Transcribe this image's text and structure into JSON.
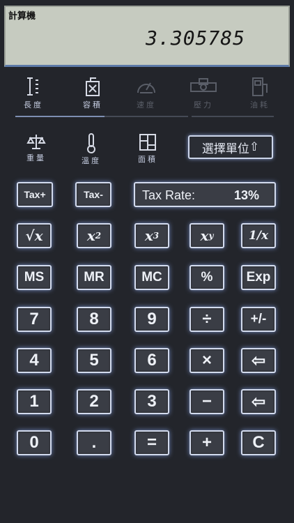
{
  "display": {
    "title": "計算機",
    "value": "3.305785"
  },
  "tabs_row1": [
    {
      "label": "長度",
      "icon": "ruler-icon"
    },
    {
      "label": "容積",
      "icon": "fuel-can-icon"
    },
    {
      "label": "速度",
      "icon": "speedometer-icon"
    },
    {
      "label": "壓力",
      "icon": "pressure-gauge-icon"
    },
    {
      "label": "油耗",
      "icon": "fuel-pump-icon"
    }
  ],
  "tabs_row2": [
    {
      "label": "重量",
      "icon": "scale-icon"
    },
    {
      "label": "溫度",
      "icon": "thermometer-icon"
    },
    {
      "label": "面積",
      "icon": "area-grid-icon"
    }
  ],
  "unit_selector": {
    "label": "選擇單位",
    "icon": "arrow-up-icon",
    "arrow": "⇧"
  },
  "tax": {
    "plus": "Tax+",
    "minus": "Tax-",
    "rate_label": "Tax Rate:",
    "rate_value": "13%"
  },
  "buttons": {
    "sqrt": "√x",
    "square_base": "x",
    "square_exp": "2",
    "cube_base": "x",
    "cube_exp": "3",
    "power_base": "x",
    "power_exp": "y",
    "reciprocal": "1/x",
    "ms": "MS",
    "mr": "MR",
    "mc": "MC",
    "percent": "%",
    "exp": "Exp",
    "n7": "7",
    "n8": "8",
    "n9": "9",
    "divide": "÷",
    "plusminus": "+/-",
    "n4": "4",
    "n5": "5",
    "n6": "6",
    "multiply": "×",
    "backspace1": "⇦",
    "n1": "1",
    "n2": "2",
    "n3": "3",
    "minus": "−",
    "backspace2": "⇦",
    "n0": "0",
    "dot": ".",
    "equals": "=",
    "plus": "+",
    "clear": "C"
  },
  "colors": {
    "background": "#23252b",
    "lcd": "#c6cbc0",
    "glow": "#6f86ba"
  }
}
